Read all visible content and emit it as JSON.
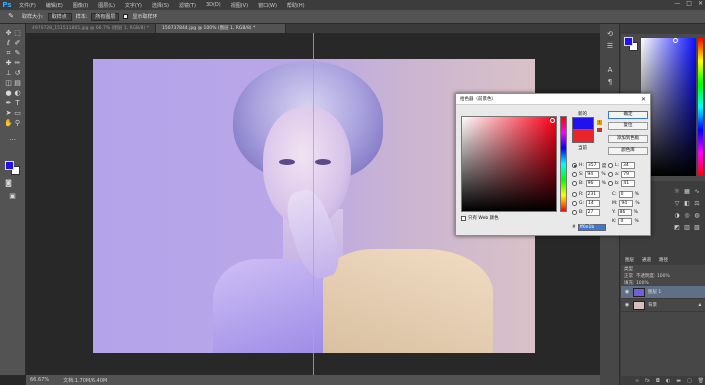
{
  "app": {
    "logo": "Ps"
  },
  "menu": [
    "文件(F)",
    "编辑(E)",
    "图像(I)",
    "图层(L)",
    "文字(Y)",
    "选择(S)",
    "滤镜(T)",
    "3D(D)",
    "视图(V)",
    "窗口(W)",
    "帮助(H)"
  ],
  "window_controls": [
    "—",
    "□",
    "✕"
  ],
  "options": {
    "tool_icon": "eyedropper-icon",
    "sample_label": "取样大小:",
    "sample_value": "取样点",
    "layer_label": "样本:",
    "layer_value": "所有图层",
    "ring_label": "显示取样环"
  },
  "doc_tabs": [
    "4970728_151511865.jpg @ 66.7% (图层 1, RGB/8) *",
    "150737844.jpg @ 100% (图层 1, RGB/8) *"
  ],
  "status": {
    "zoom": "66.67%",
    "doc": "文档:1.70M/6.40M"
  },
  "color_picker": {
    "title": "拾色器（前景色）",
    "new_label": "新的",
    "current_label": "当前",
    "buttons": {
      "ok": "确定",
      "cancel": "复位",
      "add_swatch": "添加到色板",
      "libraries": "颜色库"
    },
    "hsb": [
      {
        "label": "H:",
        "value": "357",
        "unit": "度"
      },
      {
        "label": "S:",
        "value": "94",
        "unit": "%"
      },
      {
        "label": "B:",
        "value": "96",
        "unit": "%"
      }
    ],
    "rgb": [
      {
        "label": "R:",
        "value": "231"
      },
      {
        "label": "G:",
        "value": "14"
      },
      {
        "label": "B:",
        "value": "27"
      }
    ],
    "lab": [
      {
        "label": "L:",
        "value": "34"
      },
      {
        "label": "a:",
        "value": "79"
      },
      {
        "label": "b:",
        "value": "41"
      }
    ],
    "cmyk": [
      {
        "label": "C:",
        "value": "0",
        "unit": "%"
      },
      {
        "label": "M:",
        "value": "94",
        "unit": "%"
      },
      {
        "label": "Y:",
        "value": "86",
        "unit": "%"
      },
      {
        "label": "K:",
        "value": "0",
        "unit": "%"
      }
    ],
    "web_only": "只有 Web 颜色",
    "hex_label": "#",
    "hex_value": "ff0e1b"
  },
  "layers_panel": {
    "tabs": [
      "图层",
      "通道",
      "路径"
    ],
    "filter_label": "类型",
    "blend_mode": "正常",
    "opacity_label": "不透明度: 100%",
    "fill_label": "填充: 100%",
    "layers": [
      {
        "name": "图层 1",
        "selected": true
      },
      {
        "name": "背景",
        "selected": false
      }
    ],
    "footer_icons": [
      "link-icon",
      "fx-icon",
      "mask-icon",
      "adjustment-icon",
      "folder-icon",
      "new-layer-icon",
      "trash-icon"
    ]
  },
  "colors": {
    "foreground": "#1f12ee",
    "background": "#ffffff",
    "current": "#e8252a",
    "guide": "#39d7e8"
  }
}
